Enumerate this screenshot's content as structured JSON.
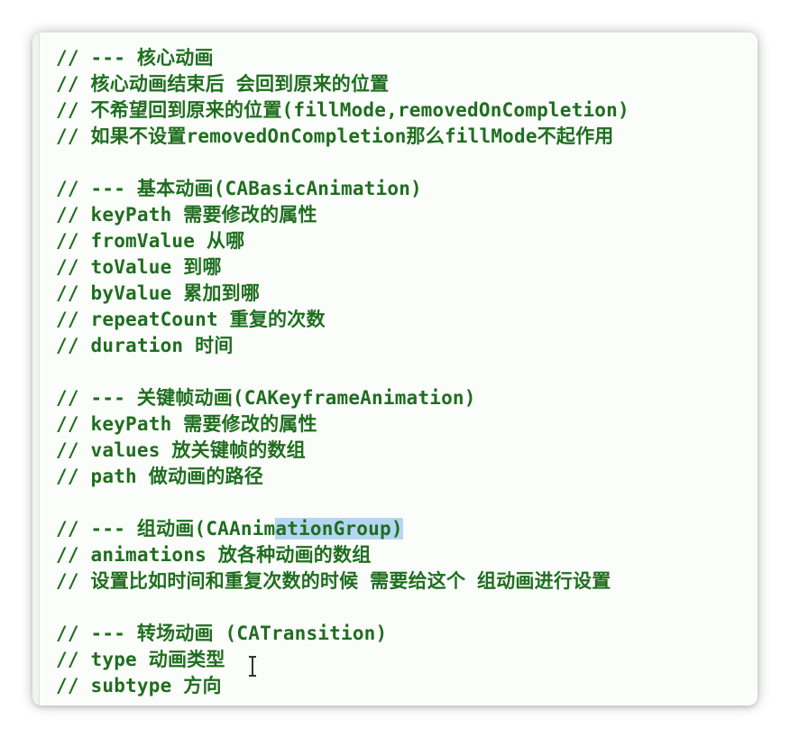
{
  "editor": {
    "lines": [
      "// --- 核心动画",
      "// 核心动画结束后 会回到原来的位置",
      "// 不希望回到原来的位置(fillMode,removedOnCompletion)",
      "// 如果不设置removedOnCompletion那么fillMode不起作用",
      "",
      "// --- 基本动画(CABasicAnimation)",
      "// keyPath 需要修改的属性",
      "// fromValue 从哪",
      "// toValue 到哪",
      "// byValue 累加到哪",
      "// repeatCount 重复的次数",
      "// duration 时间",
      "",
      "// --- 关键帧动画(CAKeyframeAnimation)",
      "// keyPath 需要修改的属性",
      "// values 放关键帧的数组",
      "// path 做动画的路径",
      "",
      "// --- 组动画(CAAnimationGroup)",
      "// animations 放各种动画的数组",
      "// 设置比如时间和重复次数的时候 需要给这个 组动画进行设置",
      "",
      "// --- 转场动画 (CATransition)",
      "// type 动画类型",
      "// subtype 方向"
    ],
    "selection": {
      "line": 18,
      "before": "// --- 组动画(CAAnim",
      "selected": "ationGroup)",
      "after": ""
    },
    "colors": {
      "comment": "#1f6e1f",
      "selection": "#b5d6f2",
      "background": "#fbfdfb"
    }
  }
}
